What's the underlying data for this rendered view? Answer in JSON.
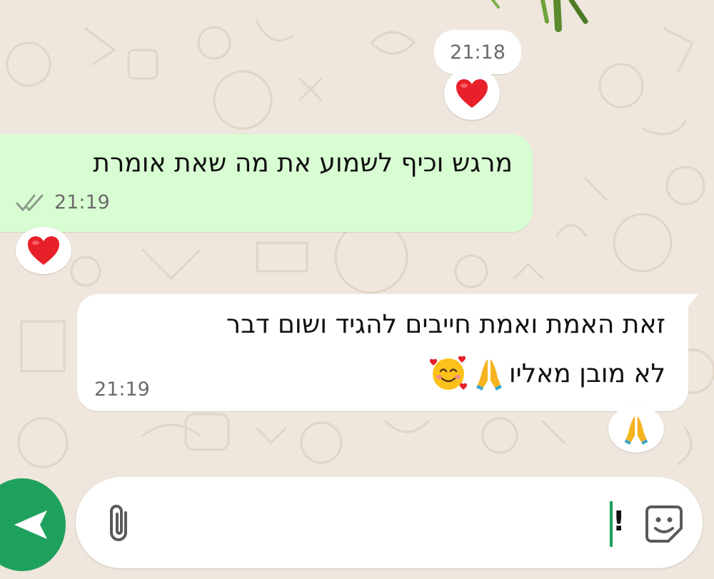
{
  "chat": {
    "date_pill": "21:18",
    "messages": [
      {
        "direction": "outgoing",
        "text": "מרגש וכיף לשמוע את מה שאת אומרת",
        "time": "21:19",
        "status": "read",
        "status_icon": "double-check-icon",
        "reaction": "❤️"
      },
      {
        "direction": "incoming",
        "line1": "זאת האמת ואמת חייבים להגיד ושום דבר",
        "line2": "לא מובן מאליו",
        "emojis": [
          "🙏",
          "🥰"
        ],
        "time": "21:19",
        "reaction": "🙏"
      }
    ],
    "top_reaction": "❤️"
  },
  "composer": {
    "typed_text": "!",
    "attach_icon": "paperclip-icon",
    "sticker_icon": "sticker-icon",
    "send_icon": "send-arrow-icon"
  },
  "colors": {
    "background": "#efe7dd",
    "outgoing_bubble": "#d8fdd2",
    "incoming_bubble": "#ffffff",
    "accent_green": "#1ea15c",
    "meta_text": "#6b6b6b"
  }
}
